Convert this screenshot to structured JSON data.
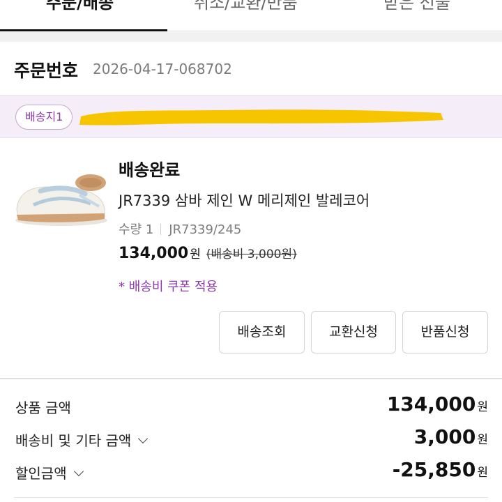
{
  "tabs": [
    {
      "label": "주문/배송",
      "active": true
    },
    {
      "label": "취소/교환/반품",
      "active": false
    },
    {
      "label": "받은 선물",
      "active": false
    }
  ],
  "order": {
    "label": "주문번호",
    "number": "2026-04-17-068702"
  },
  "destination": {
    "badge": "배송지1"
  },
  "item": {
    "status": "배송완료",
    "name": "JR7339 삼바 제인 W 메리제인 발레코어",
    "quantity": "수량 1",
    "option": "JR7339/245",
    "price": "134,000",
    "price_unit": "원",
    "shipping_strike": "(배송비 3,000원)",
    "coupon_note": "* 배송비 쿠폰 적용"
  },
  "actions": {
    "track": "배송조회",
    "exchange": "교환신청",
    "return": "반품신청"
  },
  "summary": [
    {
      "label": "상품 금액",
      "value": "134,000",
      "unit": "원",
      "expandable": false
    },
    {
      "label": "배송비 및 기타 금액",
      "value": "3,000",
      "unit": "원",
      "expandable": true
    },
    {
      "label": "할인금액",
      "value": "-25,850",
      "unit": "원",
      "expandable": true
    }
  ],
  "colors": {
    "accent_purple": "#8a3aa8",
    "redaction_yellow": "#f7c400",
    "band_lavender": "#f5eef8"
  }
}
